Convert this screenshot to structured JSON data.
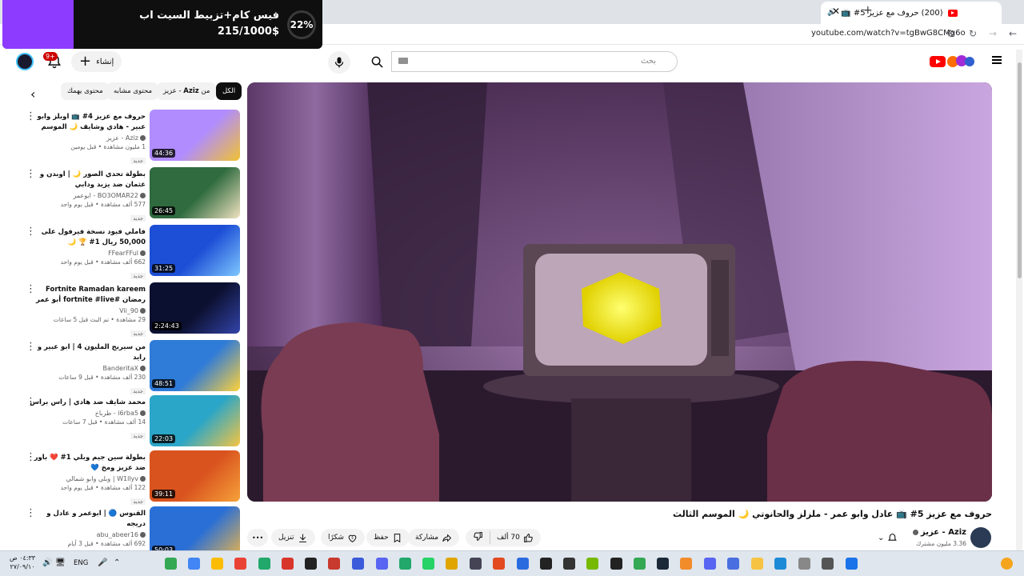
{
  "browser": {
    "tab_title": "(200) حروف مع عزيز 5# 📺",
    "url": "youtube.com/watch?v=tgBwG8CMg6o",
    "new_tab": "+",
    "tab_close": "✕"
  },
  "overlay": {
    "title": "فيس كام+تزبيط السيت اب",
    "amount": "215/1000$",
    "percent": "22%",
    "progress_fraction": 0.22
  },
  "header": {
    "notifications": "9+",
    "create_label": "إنشاء",
    "search_placeholder": "بحث"
  },
  "chips": [
    {
      "label": "الكل",
      "active": true
    },
    {
      "label_prefix": "من",
      "label_bold": "Aziz",
      "label_suffix": "- عزيز"
    },
    {
      "label": "محتوى مشابه"
    },
    {
      "label": "محتوى يهمك"
    }
  ],
  "recommendations": [
    {
      "title": "حروف مع عزيز 4# 📺 اوبلز وابو عبير - هادي وشايف 🌙 الموسم الثالث",
      "channel": "Aziz - عزيز",
      "meta": "1 مليون مشاهدة • قبل يومين",
      "badge": "جديد",
      "duration": "44:36",
      "colors": [
        "#b08cff",
        "#f1c232"
      ]
    },
    {
      "title": "بطولة تحدي الصور 🌙 | اوبدن و عثمان ضد يزيد ودابي",
      "channel": "BO3OMAR22 - ابوعمر",
      "meta": "577 ألف مشاهدة • قبل يوم واحد",
      "badge": "جديد",
      "duration": "26:45",
      "colors": [
        "#2f6b3f",
        "#f0e2c0"
      ]
    },
    {
      "title": "فاملي فيود نسخة فيرفول على 50,000 ريال 1# 🏆 🌙",
      "channel": "FFearFFul",
      "meta": "662 ألف مشاهدة • قبل يوم واحد",
      "badge": "جديد",
      "duration": "31:25",
      "colors": [
        "#1d4fd6",
        "#7fc8ff"
      ]
    },
    {
      "title": "Fortnite Ramadan kareem رمضان #fortnite #live أبو عمر with كريم ...",
      "channel": "Vii_90",
      "meta": "29 مشاهدة • تم البث قبل 5 ساعات",
      "badge": "جديد",
      "duration": "2:24:43",
      "colors": [
        "#0c1030",
        "#3344aa"
      ]
    },
    {
      "title": "من سيربح المليون 4 | ابو عبير و رايد",
      "channel": "BanderitaX",
      "meta": "230 ألف مشاهدة • قبل 9 ساعات",
      "badge": "جديد",
      "duration": "48:51",
      "colors": [
        "#2f7bd8",
        "#ffd23a"
      ]
    },
    {
      "title": "محمد شايف ضد هادي | راس براس",
      "channel": "i6rba5 - طرباخ",
      "meta": "14 ألف مشاهدة • قبل 7 ساعات",
      "badge": "جديد",
      "duration": "22:03",
      "colors": [
        "#2aa6c8",
        "#f5c542"
      ]
    },
    {
      "title": "بطولة سين جيم وبلي 1# ❤️ باور ضد عزيز ومخ 💙",
      "channel": "W1llyv | وبلي وابو شمالي",
      "meta": "122 ألف مشاهدة • قبل يوم واحد",
      "badge": "جديد",
      "duration": "39:11",
      "colors": [
        "#d9531e",
        "#f6a23a"
      ]
    },
    {
      "title": "القنوس 🔵 | ابوعمر و عادل و دريجه",
      "channel": "abu_abeer16",
      "meta": "692 ألف مشاهدة • قبل 3 أيام",
      "badge": "جديد",
      "duration": "50:03",
      "colors": [
        "#2a6fd6",
        "#e9b44c"
      ]
    }
  ],
  "video": {
    "title": "حروف مع عزيز 5# 📺 عادل وابو عمر - ملزلز والحانوتي 🌙 الموسم الثالث",
    "channel": "Aziz - عزيز",
    "subscribers": "3.36 مليون مشترك",
    "likes": "70 ألف",
    "share": "مشاركة",
    "save": "حفظ",
    "thanks": "شكرًا",
    "download": "تنزيل",
    "more": "•••"
  },
  "taskbar": {
    "time": "٠٤:٣٣ ص",
    "date": "٢٧/٠٩/١٠",
    "lang": "ENG"
  }
}
